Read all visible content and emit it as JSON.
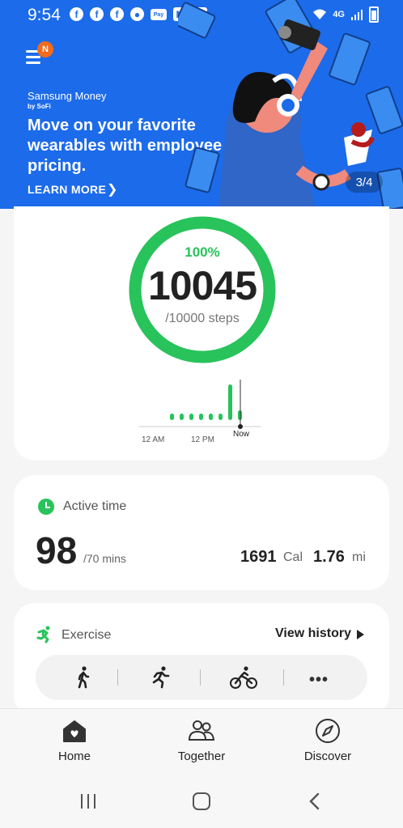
{
  "status_bar": {
    "time": "9:54",
    "network": "4G"
  },
  "banner": {
    "notification_badge": "N",
    "brand_name": "Samsung Money",
    "brand_sub": "by SoFi",
    "headline": "Move on your favorite wearables with employee pricing.",
    "cta": "LEARN MORE",
    "pager": "3/4"
  },
  "steps": {
    "percent": "100%",
    "value": "10045",
    "goal": "/10000 steps",
    "progress_fraction": 1.0,
    "chart_ticks": [
      "12 AM",
      "12 PM",
      "Now"
    ]
  },
  "active_time": {
    "title": "Active time",
    "value": "98",
    "goal": "/70 mins",
    "calories": "1691",
    "calories_unit": "Cal",
    "distance": "1.76",
    "distance_unit": "mi"
  },
  "exercise": {
    "title": "Exercise",
    "view_history": "View history",
    "types": [
      "walk-icon",
      "run-icon",
      "bike-icon",
      "more-icon"
    ]
  },
  "bottom_nav": {
    "items": [
      {
        "label": "Home",
        "icon": "home-icon"
      },
      {
        "label": "Together",
        "icon": "people-icon"
      },
      {
        "label": "Discover",
        "icon": "compass-icon"
      }
    ]
  },
  "colors": {
    "accent_green": "#28c35a",
    "banner_blue": "#1c6bea",
    "badge_orange": "#f26b1d"
  }
}
